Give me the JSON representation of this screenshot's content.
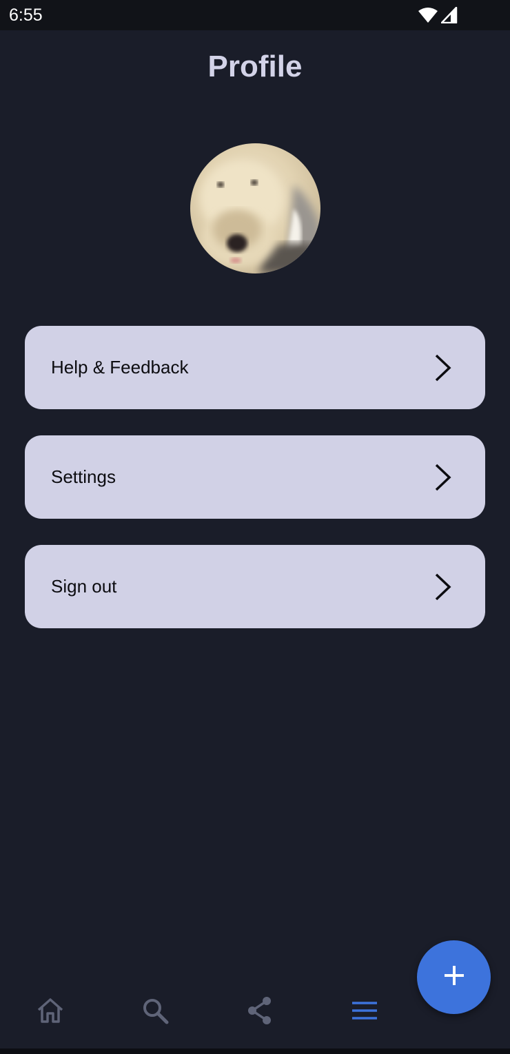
{
  "status_bar": {
    "time": "6:55",
    "icons": [
      "wifi-icon",
      "cellular-signal-icon"
    ]
  },
  "header": {
    "title": "Profile"
  },
  "profile": {
    "avatar": "dog-photo-avatar"
  },
  "menu": {
    "items": [
      {
        "label": "Help & Feedback",
        "icon": "chevron-right-icon"
      },
      {
        "label": "Settings",
        "icon": "chevron-right-icon"
      },
      {
        "label": "Sign out",
        "icon": "chevron-right-icon"
      }
    ]
  },
  "fab": {
    "icon": "plus-icon"
  },
  "bottom_nav": {
    "items": [
      {
        "icon": "home-icon",
        "active": false
      },
      {
        "icon": "search-icon",
        "active": false
      },
      {
        "icon": "share-icon",
        "active": false
      },
      {
        "icon": "menu-icon",
        "active": true
      }
    ]
  },
  "colors": {
    "background": "#1a1d29",
    "title": "#d3d3e8",
    "card": "#d1d1e6",
    "accent": "#3d73dc",
    "nav_inactive": "#5f6478",
    "nav_active": "#3d73dc"
  }
}
